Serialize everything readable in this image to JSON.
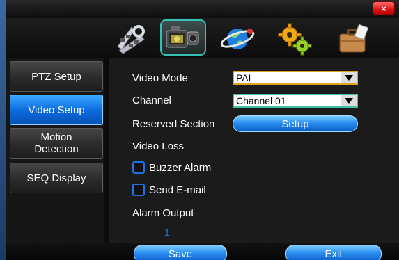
{
  "window": {
    "close_glyph": "×"
  },
  "top_tabs": [
    {
      "name": "display-icon",
      "active": false
    },
    {
      "name": "record-camera-icon",
      "active": true
    },
    {
      "name": "network-globe-icon",
      "active": false
    },
    {
      "name": "system-gears-icon",
      "active": false
    },
    {
      "name": "advanced-briefcase-icon",
      "active": false
    }
  ],
  "sidebar": {
    "items": [
      {
        "label": "PTZ Setup",
        "active": false
      },
      {
        "label": "Video Setup",
        "active": true
      },
      {
        "label": "Motion Detection",
        "active": false
      },
      {
        "label": "SEQ Display",
        "active": false
      }
    ]
  },
  "form": {
    "video_mode_label": "Video Mode",
    "video_mode_value": "PAL",
    "channel_label": "Channel",
    "channel_value": "Channel 01",
    "reserved_section_label": "Reserved Section",
    "setup_button": "Setup",
    "video_loss_label": "Video Loss",
    "buzzer_alarm_label": "Buzzer Alarm",
    "send_email_label": "Send E-mail",
    "alarm_output_label": "Alarm Output",
    "alarm_output_value": "1"
  },
  "footer": {
    "save_label": "Save",
    "exit_label": "Exit"
  },
  "colors": {
    "accent_blue": "#0a68dc",
    "tab_highlight": "#36c0b4",
    "select_border": "#e0a020",
    "close_red": "#dd1111"
  }
}
